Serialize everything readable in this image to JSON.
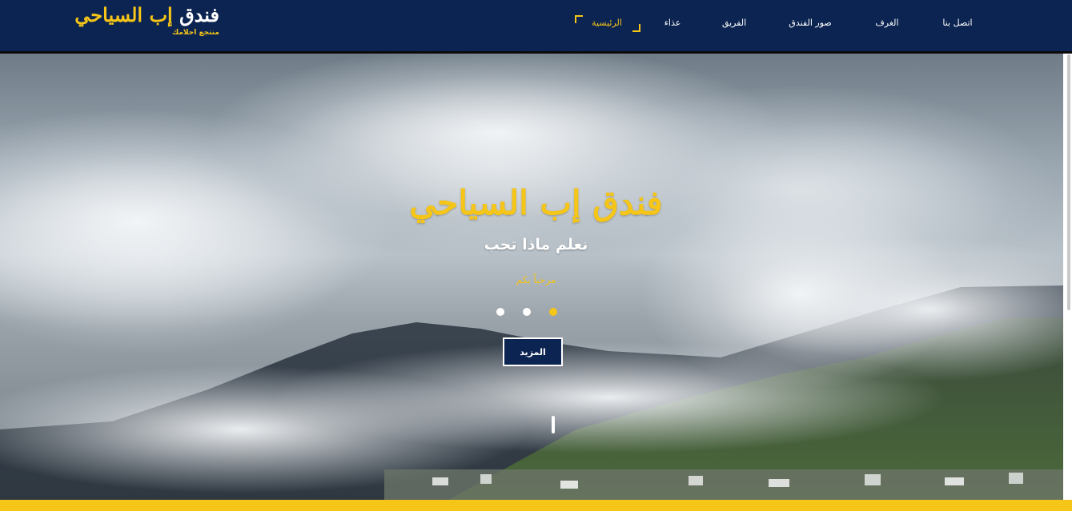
{
  "brand": {
    "name_part1": "فندق",
    "name_part2": "إب السياحي",
    "tagline": "منتجع احلامك"
  },
  "nav": {
    "items": [
      {
        "label": "الرئيسية",
        "active": true
      },
      {
        "label": "عذاء",
        "active": false
      },
      {
        "label": "الفريق",
        "active": false
      },
      {
        "label": "صور الفندق",
        "active": false
      },
      {
        "label": "الغرف",
        "active": false
      },
      {
        "label": "اتصل بنا",
        "active": false
      }
    ]
  },
  "hero": {
    "title": "فندق إب السياحي",
    "subtitle": "نعلم ماذا تحب",
    "welcome": "مرحباً بكم",
    "more_button": "المزيد",
    "slides_total": 3,
    "active_slide": 3
  },
  "colors": {
    "navy": "#0c2451",
    "accent": "#f5c518",
    "white": "#ffffff"
  }
}
